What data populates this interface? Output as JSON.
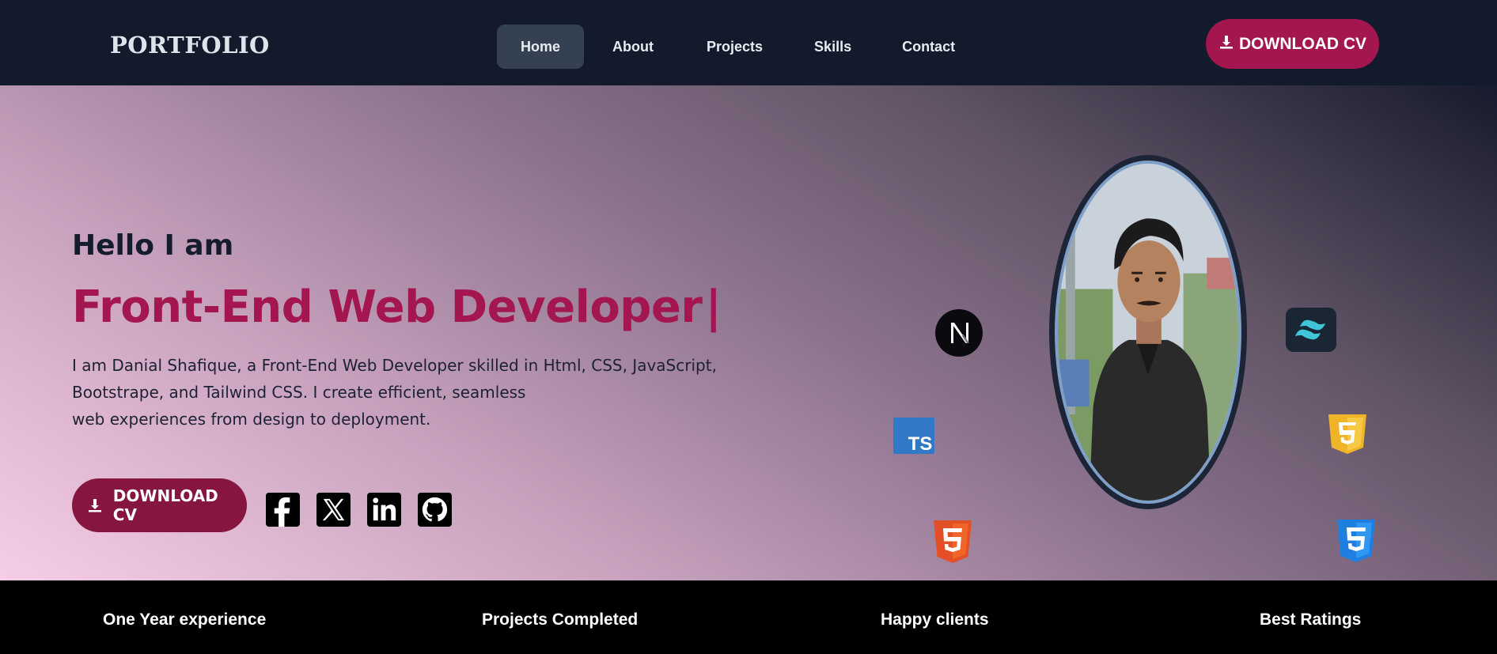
{
  "nav": {
    "logo": "PORTFOLIO",
    "links": [
      {
        "label": "Home",
        "active": true
      },
      {
        "label": "About",
        "active": false
      },
      {
        "label": "Projects",
        "active": false
      },
      {
        "label": "Skills",
        "active": false
      },
      {
        "label": "Contact",
        "active": false
      }
    ],
    "cv_label": "DOWNLOAD CV",
    "cv_icon": "download-icon"
  },
  "hero": {
    "greeting": "Hello I am",
    "title": "Front-End Web Developer",
    "cursor": "|",
    "description_lines": [
      "I am Danial Shafique, a Front-End Web Developer skilled in Html, CSS, JavaScript,",
      "Bootstrape, and Tailwind CSS. I create efficient, seamless",
      "web experiences from design to deployment."
    ],
    "cv_label": "DOWNLOAD CV",
    "socials": [
      "facebook-icon",
      "x-icon",
      "linkedin-icon",
      "github-icon"
    ],
    "tech_icons": [
      "nextjs-icon",
      "tailwind-icon",
      "typescript-icon",
      "javascript-icon",
      "html5-icon",
      "css3-icon"
    ],
    "ts_badge": "TS"
  },
  "stats": [
    "One Year experience",
    "Projects Completed",
    "Happy clients",
    "Best Ratings"
  ],
  "colors": {
    "nav_bg": "#121a2c",
    "accent": "#a3164f",
    "active_tab": "#334152",
    "stats_bg": "#000000"
  }
}
